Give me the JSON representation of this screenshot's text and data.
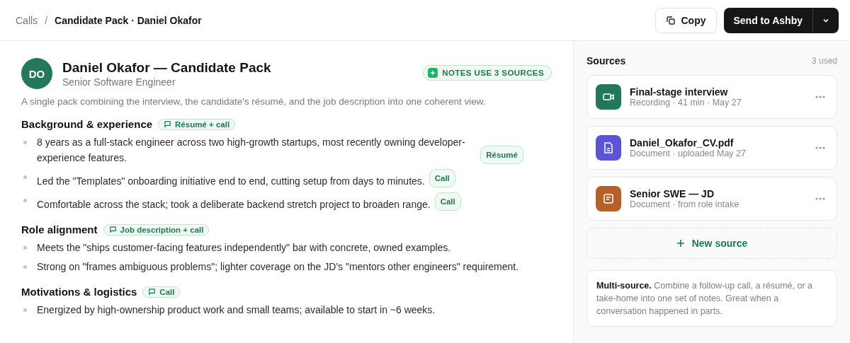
{
  "breadcrumb": {
    "parent": "Calls",
    "separator": "/",
    "current": "Candidate Pack · Daniel Okafor"
  },
  "actions": {
    "copy": "Copy",
    "send": "Send to Ashby"
  },
  "candidate": {
    "initials": "DO",
    "name": "Daniel Okafor — Candidate Pack",
    "role": "Senior Software Engineer",
    "badge": "NOTES USE 3 SOURCES",
    "summary": "A single pack combining the interview, the candidate's résumé, and the job description into one coherent view."
  },
  "sections": [
    {
      "title": "Background & experience",
      "tag": "Résumé + call",
      "bullets": [
        {
          "text": "8 years as a full-stack engineer across two high-growth startups, most recently owning developer-experience features.",
          "tag": "Résumé"
        },
        {
          "text": "Led the \"Templates\" onboarding initiative end to end, cutting setup from days to minutes.",
          "tag": "Call"
        },
        {
          "text": "Comfortable across the stack; took a deliberate backend stretch project to broaden range.",
          "tag": "Call"
        }
      ]
    },
    {
      "title": "Role alignment",
      "tag": "Job description + call",
      "bullets": [
        {
          "text": "Meets the \"ships customer-facing features independently\" bar with concrete, owned examples."
        },
        {
          "text": "Strong on \"frames ambiguous problems\"; lighter coverage on the JD's \"mentors other engineers\" requirement."
        }
      ]
    },
    {
      "title": "Motivations & logistics",
      "tag": "Call",
      "bullets": [
        {
          "text": "Energized by high-ownership product work and small teams; available to start in ~6 weeks."
        }
      ]
    }
  ],
  "sidebar": {
    "title": "Sources",
    "count": "3 used",
    "sources": [
      {
        "kind": "video",
        "color": "#23785a",
        "name": "Final-stage interview",
        "meta": "Recording · 41 min · May 27"
      },
      {
        "kind": "pdf",
        "color": "#5b55d6",
        "name": "Daniel_Okafor_CV.pdf",
        "meta": "Document · uploaded May 27"
      },
      {
        "kind": "doc",
        "color": "#b5622a",
        "name": "Senior SWE — JD",
        "meta": "Document · from role intake"
      }
    ],
    "new_source": "New source",
    "hint": "**Multi-source.** Combine a follow-up call, a résumé, or a take-home into one set of notes. Great when a conversation happened in parts."
  }
}
